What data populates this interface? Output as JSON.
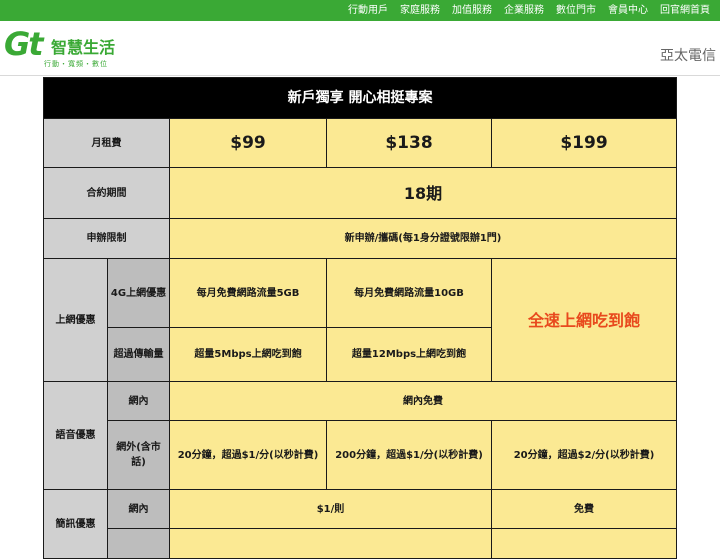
{
  "top_nav": [
    "行動用戶",
    "家庭服務",
    "加值服務",
    "企業服務",
    "數位門市",
    "會員中心",
    "回官網首頁"
  ],
  "logo": {
    "mark": "Gt",
    "title": "智慧生活",
    "subtitle": "行動・寬頻・數位"
  },
  "brand": "亞太電信",
  "colors": {
    "nav_green": "#3aa935",
    "cell_yellow": "#fbe993",
    "label_gray": "#d0d0d0",
    "highlight_red": "#e8491d"
  },
  "plan": {
    "title": "新戶獨享 開心相挺專案",
    "monthly_fee_label": "月租費",
    "prices": [
      "$99",
      "$138",
      "$199"
    ],
    "contract_label": "合約期間",
    "contract_value": "18期",
    "limit_label": "申辦限制",
    "limit_value": "新申辦/攜碼(每1身分證號限辦1門)",
    "data_label": "上網優惠",
    "data_4g_label": "4G上網優惠",
    "data_4g_values": [
      "每月免費網路流量5GB",
      "每月免費網路流量10GB"
    ],
    "data_unlimited": "全速上網吃到飽",
    "data_over_label": "超過傳輸量",
    "data_over_values": [
      "超量5Mbps上網吃到飽",
      "超量12Mbps上網吃到飽"
    ],
    "voice_label": "語音優惠",
    "voice_onnet_label": "網內",
    "voice_onnet_value": "網內免費",
    "voice_offnet_label": "網外(含市話)",
    "voice_offnet_values": [
      "20分鐘，超過$1/分(以秒計費)",
      "200分鐘，超過$1/分(以秒計費)",
      "20分鐘，超過$2/分(以秒計費)"
    ],
    "sms_label": "簡訊優惠",
    "sms_onnet_label": "網內",
    "sms_onnet_values": [
      "$1/則",
      "免費"
    ]
  }
}
